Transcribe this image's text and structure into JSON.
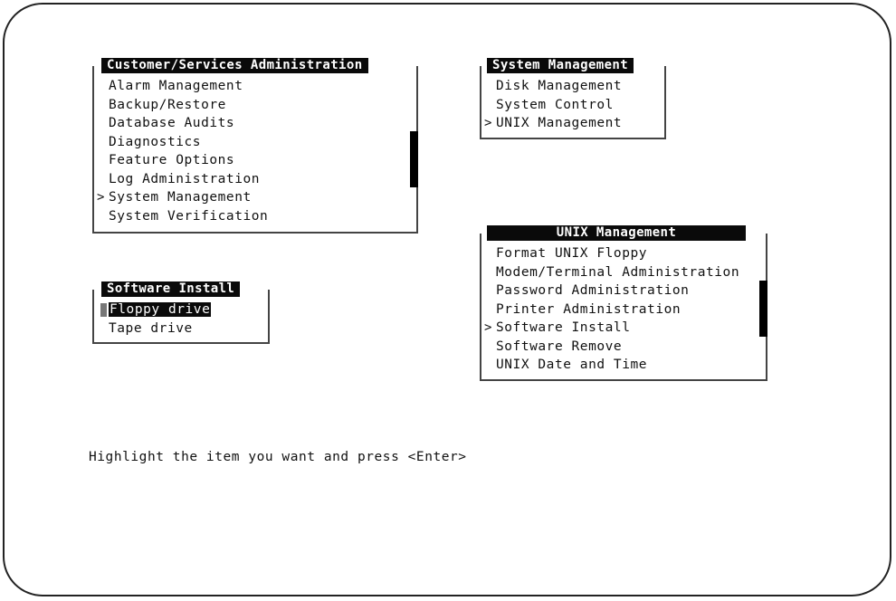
{
  "menus": {
    "customer": {
      "title": "Customer/Services Administration",
      "items": [
        {
          "label": "Alarm Management",
          "marker": ""
        },
        {
          "label": "Backup/Restore",
          "marker": ""
        },
        {
          "label": "Database Audits",
          "marker": ""
        },
        {
          "label": "Diagnostics",
          "marker": ""
        },
        {
          "label": "Feature Options",
          "marker": ""
        },
        {
          "label": "Log Administration",
          "marker": ""
        },
        {
          "label": "System Management",
          "marker": ">"
        },
        {
          "label": "System Verification",
          "marker": ""
        }
      ]
    },
    "system": {
      "title": "System Management",
      "items": [
        {
          "label": "Disk Management",
          "marker": ""
        },
        {
          "label": "System Control",
          "marker": ""
        },
        {
          "label": "UNIX Management",
          "marker": ">"
        }
      ]
    },
    "unix": {
      "title": "UNIX Management",
      "items": [
        {
          "label": "Format UNIX Floppy",
          "marker": ""
        },
        {
          "label": "Modem/Terminal Administration",
          "marker": ""
        },
        {
          "label": "Password Administration",
          "marker": ""
        },
        {
          "label": "Printer Administration",
          "marker": ""
        },
        {
          "label": "Software Install",
          "marker": ">"
        },
        {
          "label": "Software Remove",
          "marker": ""
        },
        {
          "label": "UNIX Date and Time",
          "marker": ""
        }
      ]
    },
    "software": {
      "title": "Software Install",
      "items": [
        {
          "label": "Floppy drive",
          "marker": "",
          "highlighted": true
        },
        {
          "label": "Tape drive",
          "marker": ""
        }
      ]
    }
  },
  "prompt": "Highlight the item you want and press <Enter>",
  "colors": {
    "highlight_bg": "#0a0a0a",
    "highlight_fg": "#ffffff",
    "border": "#444444"
  }
}
